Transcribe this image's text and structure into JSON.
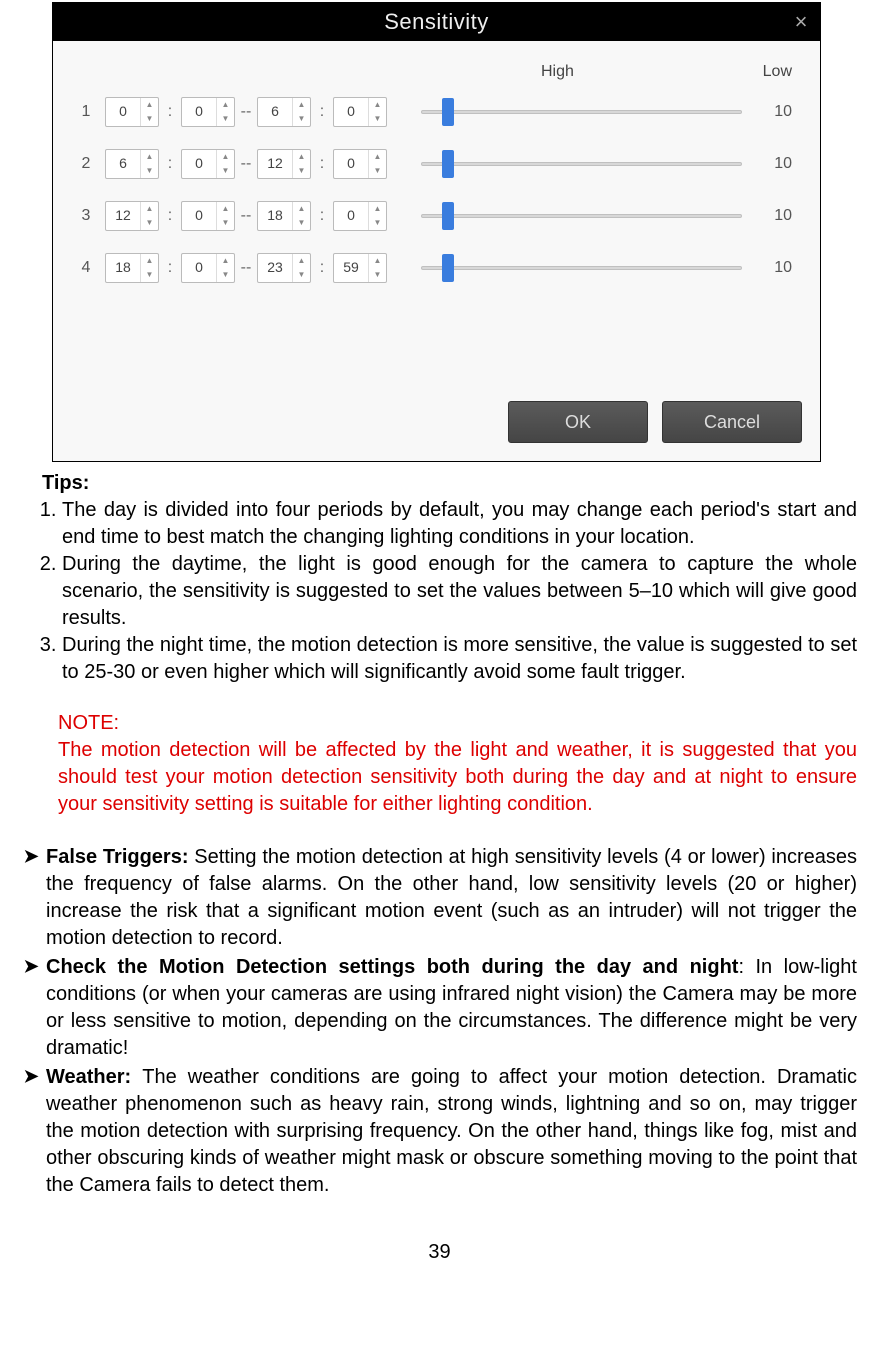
{
  "dialog": {
    "title": "Sensitivity",
    "close": "×",
    "headers": {
      "high": "High",
      "low": "Low"
    },
    "rows": [
      {
        "idx": "1",
        "sh": "0",
        "sm": "0",
        "eh": "6",
        "em": "0",
        "val": "10"
      },
      {
        "idx": "2",
        "sh": "6",
        "sm": "0",
        "eh": "12",
        "em": "0",
        "val": "10"
      },
      {
        "idx": "3",
        "sh": "12",
        "sm": "0",
        "eh": "18",
        "em": "0",
        "val": "10"
      },
      {
        "idx": "4",
        "sh": "18",
        "sm": "0",
        "eh": "23",
        "em": "59",
        "val": "10"
      }
    ],
    "buttons": {
      "ok": "OK",
      "cancel": "Cancel"
    }
  },
  "tips": {
    "title": "Tips:",
    "items": [
      "The day is divided into four periods by default, you may change each period's start and end time to best match the changing lighting conditions in your location.",
      "During the daytime, the light is good enough for the camera to capture the whole scenario, the sensitivity is suggested to set the values between 5–10 which will give good results.",
      "During the night time, the motion detection is more sensitive, the value is suggested to set to 25-30 or even higher which will significantly avoid some fault trigger."
    ]
  },
  "note": {
    "label": "NOTE:",
    "body": "The motion detection will be affected by the light and weather, it is suggested that you should test your motion detection sensitivity both during the day and at night to ensure your sensitivity setting is suitable for either lighting condition."
  },
  "bullets": [
    {
      "lead": "False Triggers: ",
      "rest": "Setting the motion detection at high sensitivity levels (4 or lower) increases the frequency of false alarms. On the other hand, low sensitivity levels (20 or higher) increase the risk that a significant motion event (such as an intruder) will not trigger the motion detection to record."
    },
    {
      "lead": "Check the Motion Detection settings both during the day and night",
      "rest": ": In low-light conditions (or when your cameras are using infrared night vision) the Camera may be more or less sensitive to motion, depending on the circumstances. The difference might be very dramatic!"
    },
    {
      "lead": "Weather: ",
      "rest": "The weather conditions are going to affect your motion detection. Dramatic weather phenomenon such as heavy rain, strong winds, lightning and so on, may trigger the motion detection with surprising frequency. On the other hand, things like fog, mist and other obscuring kinds of weather might mask or obscure something moving to the point that the Camera fails to detect them."
    }
  ],
  "page": "39"
}
